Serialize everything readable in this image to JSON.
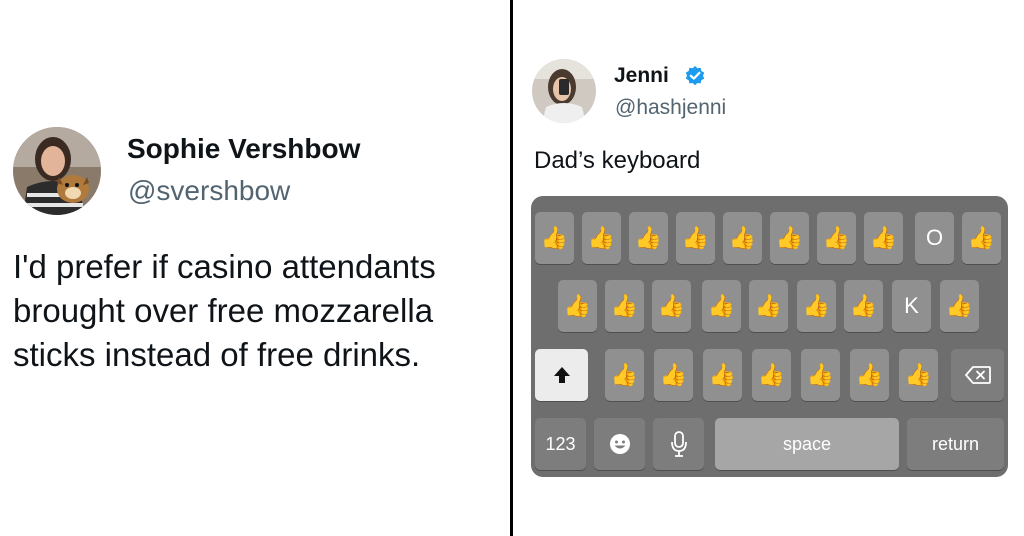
{
  "left_tweet": {
    "name": "Sophie Vershbow",
    "handle": "@svershbow",
    "body_lines": [
      "I'd prefer if casino attendants",
      "brought over free mozzarella",
      "sticks instead of free drinks."
    ]
  },
  "right_tweet": {
    "name": "Jenni",
    "handle": "@hashjenni",
    "verified": true,
    "body": "Dad’s keyboard",
    "keyboard": {
      "row1": [
        "👍",
        "👍",
        "👍",
        "👍",
        "👍",
        "👍",
        "👍",
        "👍",
        "O",
        "👍"
      ],
      "row2": [
        "👍",
        "👍",
        "👍",
        "👍",
        "👍",
        "👍",
        "👍",
        "K",
        "👍"
      ],
      "row3": [
        "👍",
        "👍",
        "👍",
        "👍",
        "👍",
        "👍",
        "👍"
      ],
      "bottom": {
        "numbers": "123",
        "space": "space",
        "return": "return"
      },
      "icons": {
        "shift": "shift-icon",
        "delete": "delete-icon",
        "emoji": "emoji-icon",
        "mic": "microphone-icon"
      }
    }
  },
  "colors": {
    "text": "#0f1419",
    "handle": "#536471",
    "verified": "#1d9bf0",
    "keyboard_bg": "#6e6e6e",
    "key": "#909090"
  }
}
